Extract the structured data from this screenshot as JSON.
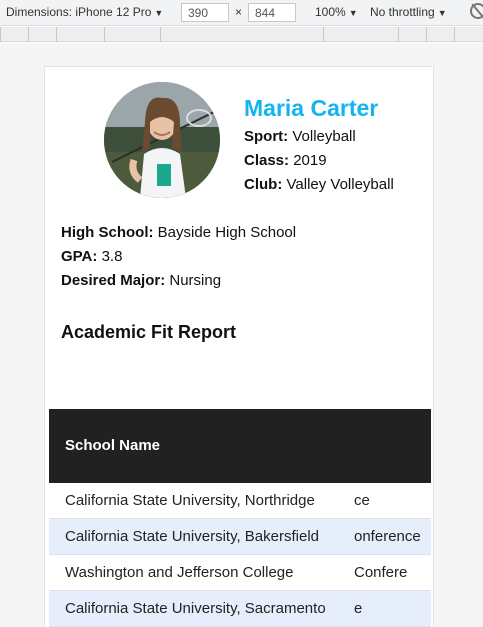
{
  "toolbar": {
    "device_label": "Dimensions: iPhone 12 Pro",
    "width": "390",
    "times": "×",
    "height": "844",
    "zoom": "100%",
    "throttle": "No throttling"
  },
  "profile": {
    "name": "Maria Carter",
    "sport_label": "Sport:",
    "sport": "Volleyball",
    "class_label": "Class:",
    "class": "2019",
    "club_label": "Club:",
    "club": "Valley Volleyball",
    "high_school_label": "High School:",
    "high_school": "Bayside High School",
    "gpa_label": "GPA:",
    "gpa": "3.8",
    "major_label": "Desired Major:",
    "major": "Nursing"
  },
  "report": {
    "title": "Academic Fit Report",
    "header": "School Name",
    "rows": [
      {
        "school": "California State University, Northridge",
        "extra": "ce"
      },
      {
        "school": "California State University, Bakersfield",
        "extra": "onference"
      },
      {
        "school": "Washington and Jefferson College",
        "extra": "Confere"
      },
      {
        "school": "California State University, Sacramento",
        "extra": "e"
      }
    ]
  }
}
